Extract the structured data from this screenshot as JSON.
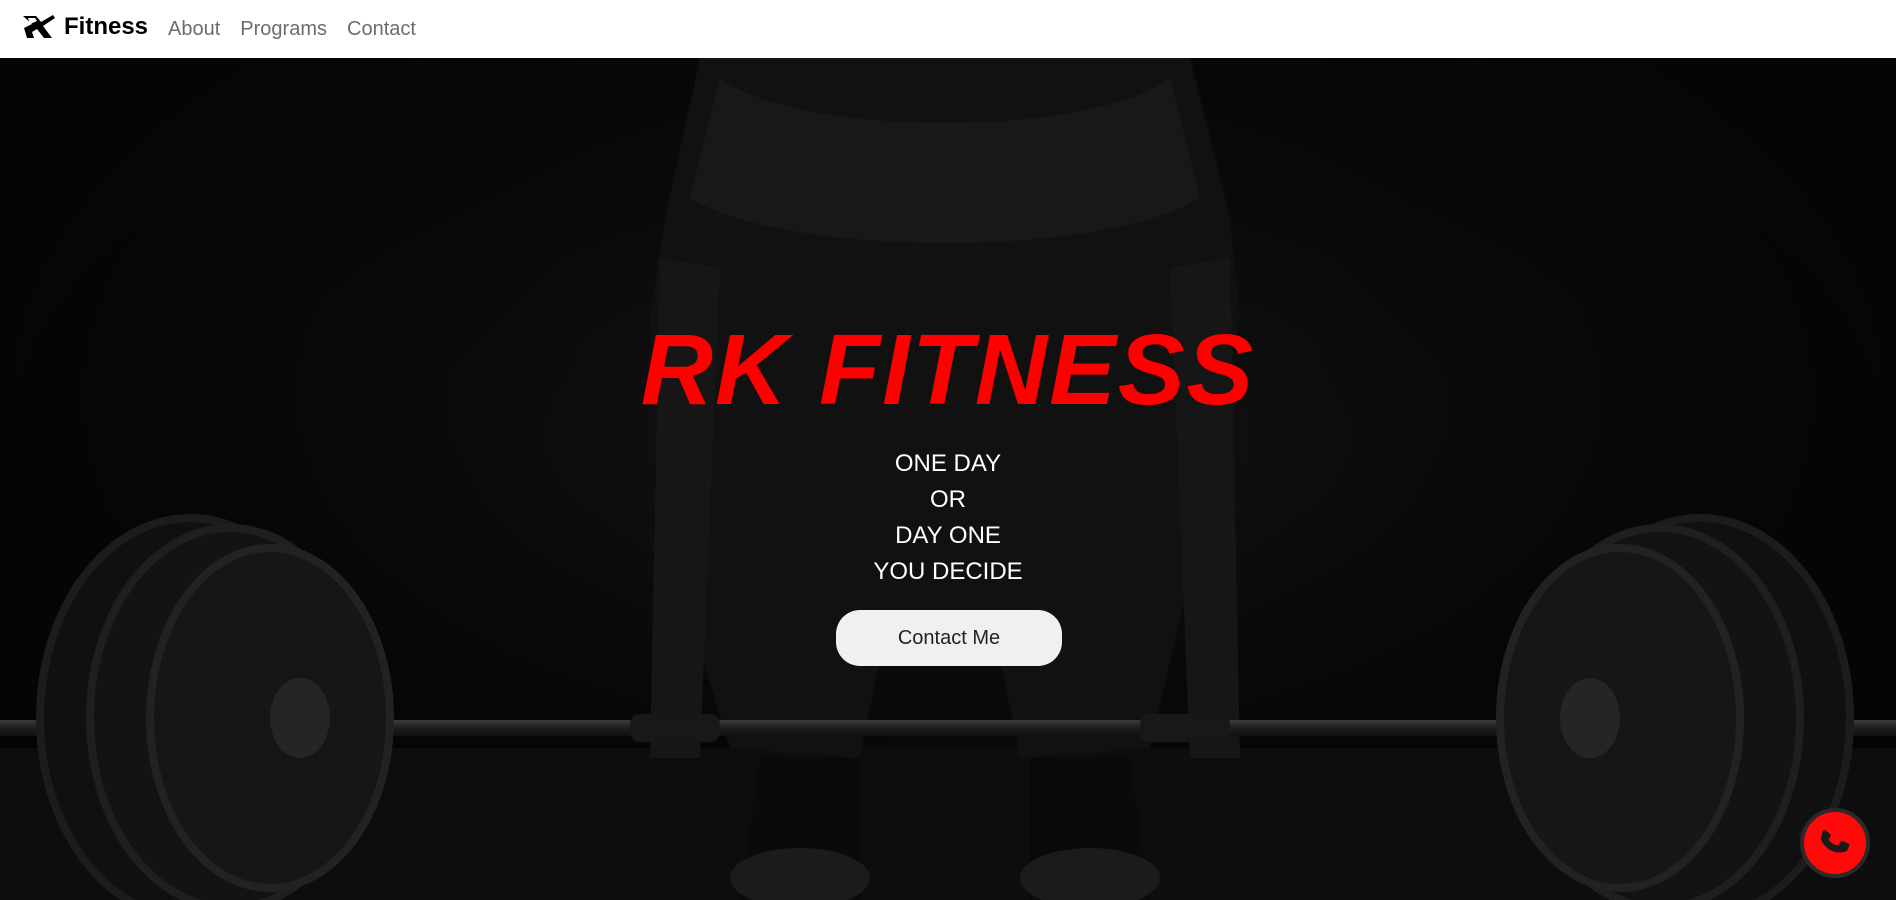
{
  "brand": {
    "name": "Fitness"
  },
  "nav": {
    "items": [
      {
        "label": "About"
      },
      {
        "label": "Programs"
      },
      {
        "label": "Contact"
      }
    ]
  },
  "hero": {
    "title": "RK FITNESS",
    "tagline": [
      "ONE DAY",
      "OR",
      "DAY ONE",
      "YOU DECIDE"
    ],
    "cta_label": "Contact Me"
  },
  "icons": {
    "logo": "rk-logo-icon",
    "call": "phone-icon"
  },
  "colors": {
    "accent": "#ff0000",
    "nav_bg": "#ffffff",
    "hero_bg": "#000000",
    "button_bg": "#f0f0f0"
  }
}
